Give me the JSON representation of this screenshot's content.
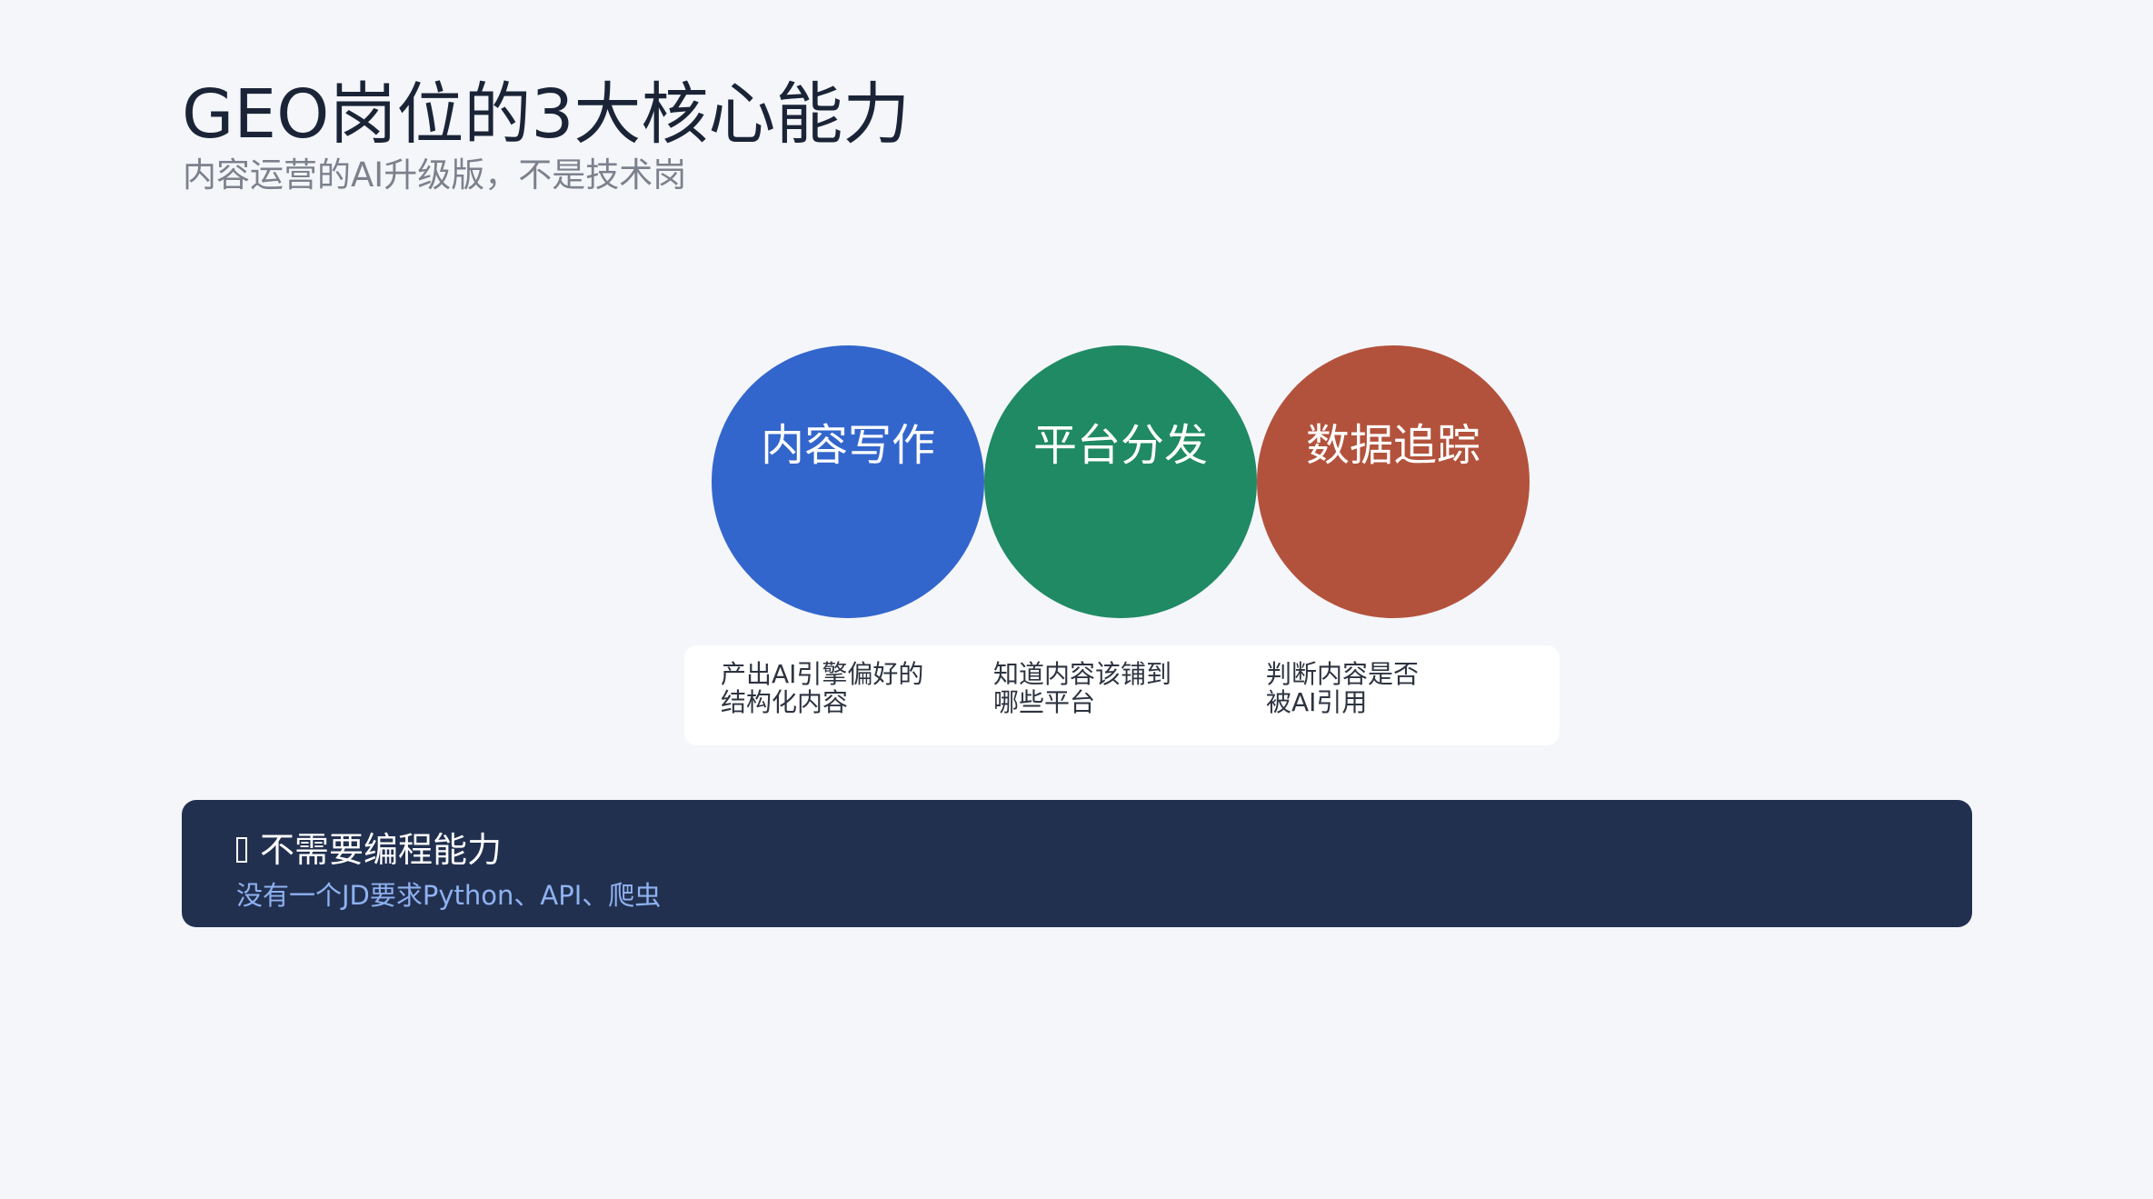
{
  "header": {
    "title": "GEO岗位的3大核心能力",
    "subtitle": "内容运营的AI升级版，不是技术岗"
  },
  "capabilities": [
    {
      "label": "内容写作",
      "color": "#3366cc",
      "desc_line1": "产出AI引擎偏好的",
      "desc_line2": "结构化内容"
    },
    {
      "label": "平台分发",
      "color": "#1f8a63",
      "desc_line1": "知道内容该铺到",
      "desc_line2": "哪些平台"
    },
    {
      "label": "数据追踪",
      "color": "#b3523c",
      "desc_line1": "判断内容是否",
      "desc_line2": "被AI引用"
    }
  ],
  "callout": {
    "icon": "glyph-box-icon",
    "title": "不需要编程能力",
    "subtitle": "没有一个JD要求Python、API、爬虫"
  }
}
